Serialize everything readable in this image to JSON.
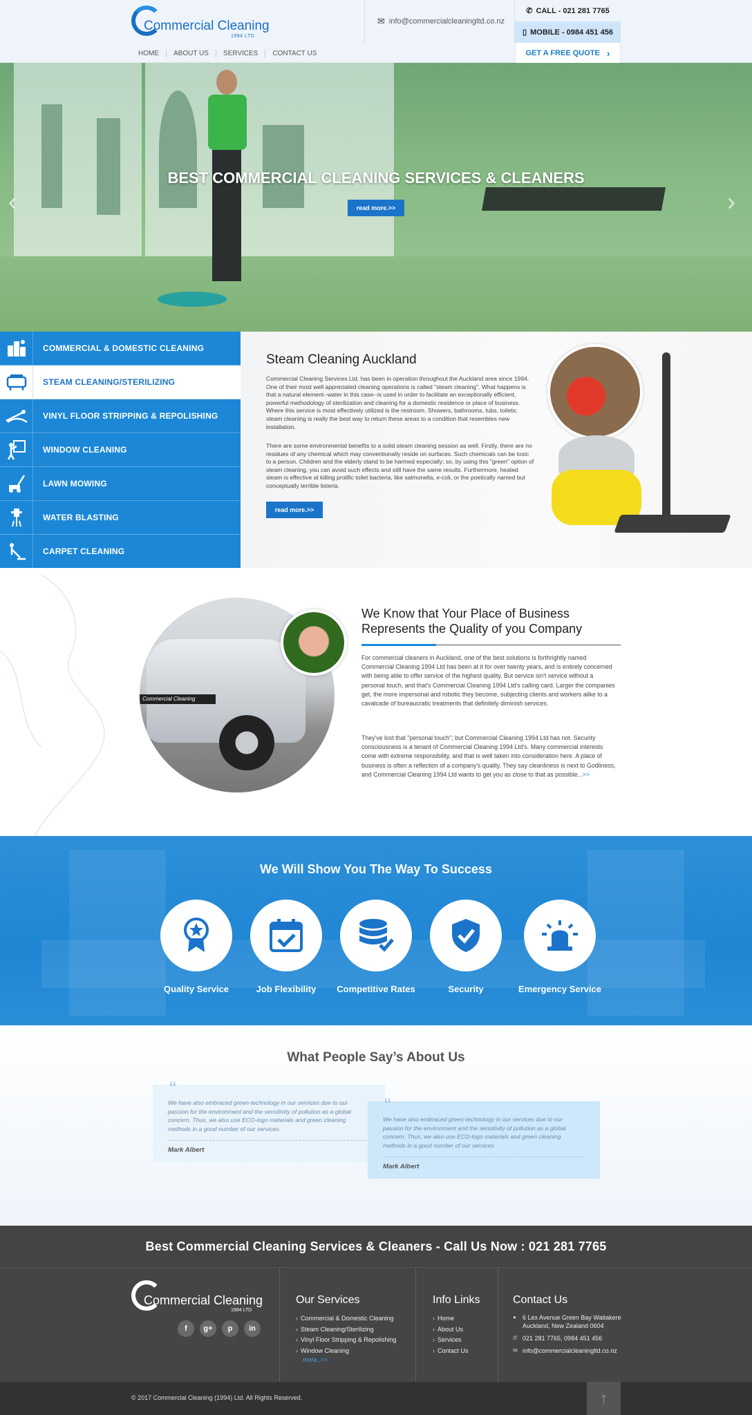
{
  "brand": {
    "name": "Commercial Cleaning",
    "sub": "1994 LTD"
  },
  "header": {
    "email": "info@commercialcleaningltd.co.nz",
    "call": "CALL - 021 281 7765",
    "mobile": "MOBILE - 0984 451 456",
    "quote": "GET A FREE QUOTE"
  },
  "nav": [
    "HOME",
    "ABOUT US",
    "SERVICES",
    "CONTACT US"
  ],
  "hero": {
    "title": "BEST COMMERCIAL CLEANING SERVICES & CLEANERS",
    "button": "read more.>>"
  },
  "services": [
    {
      "label": "COMMERCIAL & DOMESTIC CLEANING",
      "icon": "building-icon"
    },
    {
      "label": "STEAM CLEANING/STERILIZING",
      "icon": "steam-machine-icon"
    },
    {
      "label": "VINYL FLOOR STRIPPING & REPOLISHING",
      "icon": "floor-polish-icon"
    },
    {
      "label": "WINDOW CLEANING",
      "icon": "window-cleaner-icon"
    },
    {
      "label": "LAWN MOWING",
      "icon": "lawn-mower-icon"
    },
    {
      "label": "WATER BLASTING",
      "icon": "water-blaster-icon"
    },
    {
      "label": "CARPET CLEANING",
      "icon": "vacuum-icon"
    }
  ],
  "active_service": 1,
  "steam": {
    "title": "Steam Cleaning Auckland",
    "p1": "Commercial Cleaning Services Ltd. has been in operation throughout the Auckland area since 1994. One of their most well appreciated cleaning operations is called \"steam cleaning\". What happens is that a natural element--water in this case--is used in order to facilitate an exceptionally efficient, powerful methodology of sterilization and cleaning for a domestic residence or place of business. Where this service is most effectively utilized is the restroom. Showers, bathrooms, tubs, toilets; steam cleaning is really the best way to return these areas to a condition that resembles new installation.",
    "p2": "There are some environmental benefits to a solid steam cleaning session as well. Firstly, there are no residues of any chemical which may conventionally reside on surfaces. Such chemicals can be toxic to a person. Children and the elderly stand to be harmed especially; so, by using this \"green\" option of steam cleaning, you can avoid such effects and still have the same results. Furthermore, heated steam is effective at killing prolific toilet bacteria, like salmonella, e-coli, or the poetically named but conceptually terrible listeria.",
    "button": "read more.>>"
  },
  "know": {
    "title": "We Know that Your Place of Business Represents the Quality of you Company",
    "p1": "For commercial cleaners in Auckland, one of the best solutions is forthrightly named Commercial Cleaning 1994 Ltd has been at it for over twenty years, and is entirely concerned with being able to offer service of the highest quality.  But service isn't service without a personal touch, and that's Commercial Cleaning 1994 Ltd's calling card. Larger the companies get, the more impersonal and robotic they become, subjecting clients and workers alike to a cavalcade of bureaucratic treatments that definitely diminish services.",
    "p2": "They've lost that \"personal touch\"; but Commercial Cleaning 1994 Ltd has not.  Security consciousness is a tenant of Commercial Cleaning 1994 Ltd's.  Many commercial interests come with extreme responsibility, and that is well taken into consideration here.  A place of business is often a reflection of a company's quality.  They say cleanliness is next to Godliness, and Commercial Cleaning 1994 Ltd wants to get you as close to that as possible.",
    "more": "..>>",
    "car_tag": "Commercial Cleaning"
  },
  "success": {
    "title": "We Will Show You The Way To Success",
    "features": [
      {
        "label": "Quality Service",
        "icon": "award-ribbon-icon"
      },
      {
        "label": "Job Flexibility",
        "icon": "calendar-check-icon"
      },
      {
        "label": "Competitive Rates",
        "icon": "database-check-icon"
      },
      {
        "label": "Security",
        "icon": "shield-check-icon"
      },
      {
        "label": "Emergency Service",
        "icon": "siren-icon"
      }
    ]
  },
  "testimonials": {
    "title": "What People Say’s About Us",
    "items": [
      {
        "text": "We have also embraced green-technology in our services due to our passion for the environment and the sensitivity of pollution as a global concern. Thus, we also use ECO-logo materials and green cleaning methods in a good number of our services.",
        "author": "Mark Albert"
      },
      {
        "text": "We have also embraced green-technology in our services due to our passion for the environment and the sensitivity of pollution as a global concern. Thus, we also use ECO-logo materials and green cleaning methods in a good number of our services.",
        "author": "Mark Albert"
      }
    ]
  },
  "cta": "Best Commercial Cleaning Services & Cleaners - Call Us Now : 021 281 7765",
  "footer": {
    "social": [
      "f",
      "g+",
      "p",
      "in"
    ],
    "services_title": "Our Services",
    "services": [
      "Commercial & Domestic Cleaning",
      "Steam Cleaning/Sterilizing",
      "Vinyl Floor Stripping & Repolishing",
      "Window Cleaning"
    ],
    "services_more": "more..>>",
    "info_title": "Info Links",
    "info": [
      "Home",
      "About Us",
      "Services",
      "Contact Us"
    ],
    "contact_title": "Contact Us",
    "address": "6 Lex Avenue Green Bay Waitakere Auckland, New Zealand 0604",
    "phones": "021 281 7765, 0984 451 456",
    "email": "info@commercialcleaningltd.co.nz"
  },
  "copyright": "© 2017 Commercial Cleaning (1994) Ltd. All Rights Reserved.",
  "colors": {
    "primary": "#1b87d6",
    "dark": "#454545",
    "hero_overlay": "#7fb27a"
  }
}
